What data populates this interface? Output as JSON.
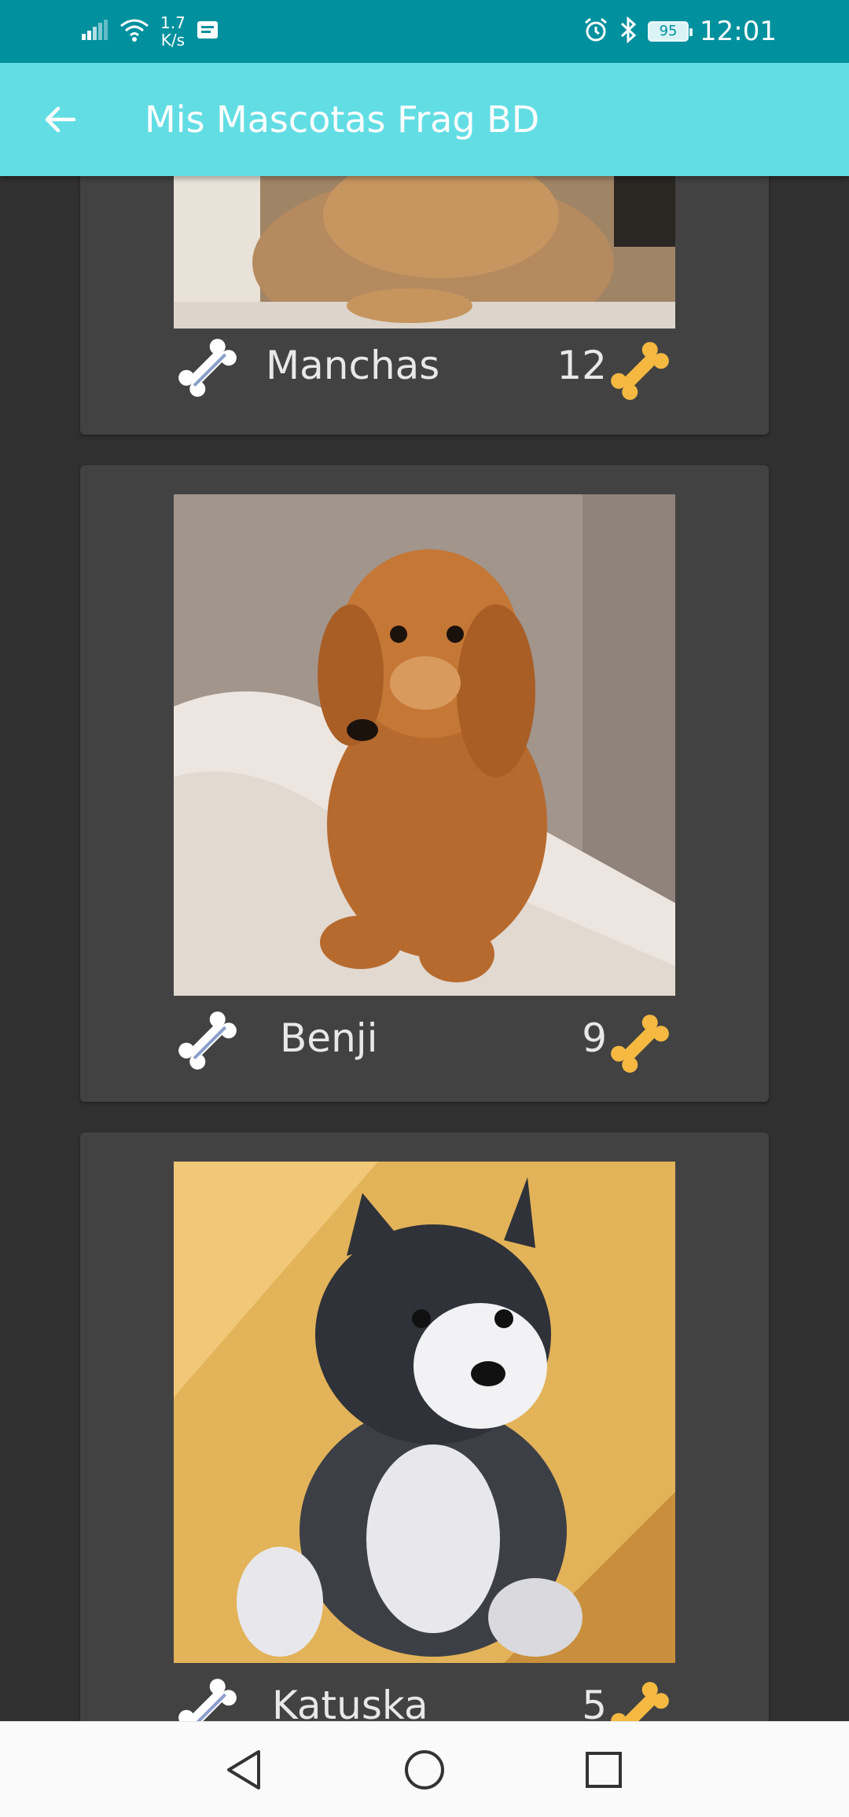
{
  "status_bar": {
    "network_speed_value": "1.7",
    "network_speed_unit": "K/s",
    "battery_level": "95",
    "time": "12:01",
    "icons": [
      "signal-icon",
      "wifi-icon",
      "notification-icon",
      "alarm-icon",
      "bluetooth-icon",
      "battery-icon"
    ]
  },
  "toolbar": {
    "title": "Mis Mascotas Frag BD",
    "back_icon": "arrow-back-icon",
    "background_color": "#63dde4"
  },
  "pets": [
    {
      "name": "Manchas",
      "rating": "12",
      "rate_icon": "bone-white-icon",
      "rating_icon": "bone-yellow-icon"
    },
    {
      "name": "Benji",
      "rating": "9",
      "rate_icon": "bone-white-icon",
      "rating_icon": "bone-yellow-icon"
    },
    {
      "name": "Katuska",
      "rating": "5",
      "rate_icon": "bone-white-icon",
      "rating_icon": "bone-yellow-icon"
    }
  ],
  "nav_bar": {
    "icons": [
      "back-triangle-icon",
      "home-circle-icon",
      "recents-square-icon"
    ]
  },
  "colors": {
    "status_bar": "#00909e",
    "background": "#303030",
    "card": "#424242",
    "bone_yellow": "#f5b942",
    "bone_white": "#ffffff"
  }
}
